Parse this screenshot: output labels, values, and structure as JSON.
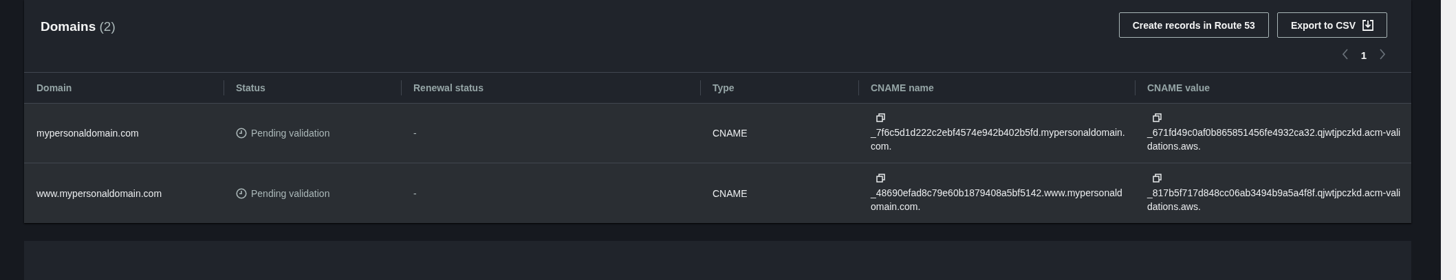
{
  "panel": {
    "title": "Domains",
    "count": "(2)",
    "buttons": [
      {
        "label": "Create records in Route 53",
        "kind": "plain"
      },
      {
        "label": "Export to CSV",
        "kind": "export"
      }
    ],
    "pagination": {
      "pages": [
        {
          "label": "1",
          "selected": true
        }
      ]
    }
  },
  "table": {
    "columns": [
      "Domain",
      "Status",
      "Renewal status",
      "Type",
      "CNAME name",
      "CNAME value"
    ],
    "rows": [
      {
        "domain": "mypersonaldomain.com",
        "status": "Pending validation",
        "renewal_status": "-",
        "type": "CNAME",
        "cname_name": "_7f6c5d1d222c2ebf4574e942b402b5fd.mypersonaldomain.com.",
        "cname_value": "_671fd49c0af0b865851456fe4932ca32.qjwtjpczkd.acm-validations.aws."
      },
      {
        "domain": "www.mypersonaldomain.com",
        "status": "Pending validation",
        "renewal_status": "-",
        "type": "CNAME",
        "cname_name": "_48690efad8c79e60b1879408a5bf5142.www.mypersonaldomain.com.",
        "cname_value": "_817b5f717d848cc06ab3494b9a5a4f8f.qjwtjpczkd.acm-validations.aws."
      }
    ]
  }
}
